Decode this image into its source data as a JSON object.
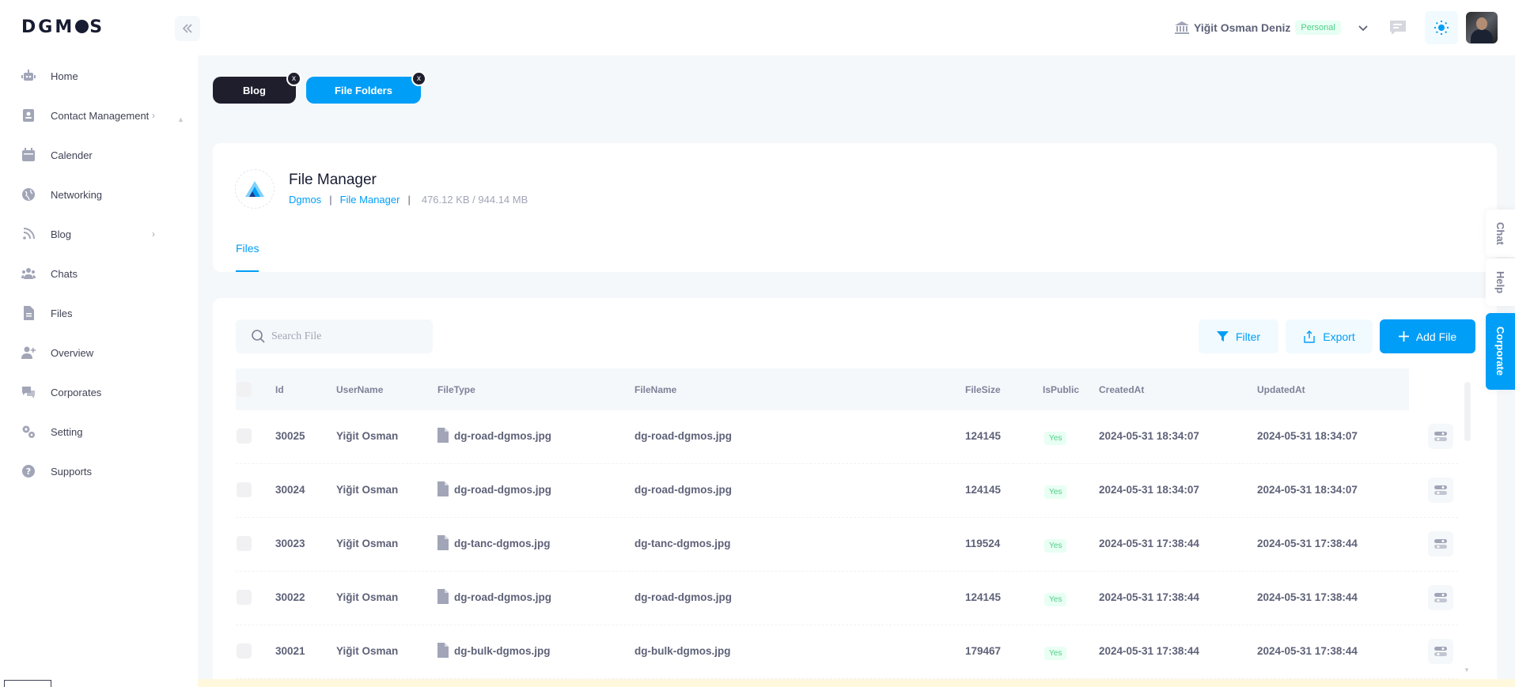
{
  "header": {
    "logo": "DGM",
    "logo_tail": "S",
    "user_name": "Yiğit Osman Deniz",
    "account_type": "Personal"
  },
  "sidebar": {
    "items": [
      {
        "label": "Home",
        "icon": "robot-icon"
      },
      {
        "label": "Contact Management",
        "icon": "contact-book-icon",
        "has_arrow": true
      },
      {
        "label": "Calender",
        "icon": "calendar-icon"
      },
      {
        "label": "Networking",
        "icon": "globe-icon"
      },
      {
        "label": "Blog",
        "icon": "rss-icon",
        "has_arrow": true
      },
      {
        "label": "Chats",
        "icon": "users-icon"
      },
      {
        "label": "Files",
        "icon": "file-icon"
      },
      {
        "label": "Overview",
        "icon": "user-plus-icon"
      },
      {
        "label": "Corporates",
        "icon": "chat-bubbles-icon"
      },
      {
        "label": "Setting",
        "icon": "gears-icon"
      },
      {
        "label": "Supports",
        "icon": "question-icon"
      }
    ]
  },
  "open_tabs": [
    {
      "label": "Blog",
      "close": "x"
    },
    {
      "label": "File Folders",
      "close": "x"
    }
  ],
  "file_manager": {
    "title": "File Manager",
    "crumb_root": "Dgmos",
    "crumb_current": "File Manager",
    "separator": "|",
    "storage": "476.12 KB / 944.14 MB",
    "tab_files": "Files"
  },
  "toolbar": {
    "search_placeholder": "Search File",
    "filter_label": "Filter",
    "export_label": "Export",
    "add_label": "Add File"
  },
  "table": {
    "columns": [
      "Id",
      "UserName",
      "FileType",
      "FileName",
      "FileSize",
      "IsPublic",
      "CreatedAt",
      "UpdatedAt"
    ],
    "rows": [
      {
        "id": "30025",
        "user": "Yiğit Osman",
        "type": "dg-road-dgmos.jpg",
        "name": "dg-road-dgmos.jpg",
        "size": "124145",
        "public": "Yes",
        "created": "2024-05-31 18:34:07",
        "updated": "2024-05-31 18:34:07"
      },
      {
        "id": "30024",
        "user": "Yiğit Osman",
        "type": "dg-road-dgmos.jpg",
        "name": "dg-road-dgmos.jpg",
        "size": "124145",
        "public": "Yes",
        "created": "2024-05-31 18:34:07",
        "updated": "2024-05-31 18:34:07"
      },
      {
        "id": "30023",
        "user": "Yiğit Osman",
        "type": "dg-tanc-dgmos.jpg",
        "name": "dg-tanc-dgmos.jpg",
        "size": "119524",
        "public": "Yes",
        "created": "2024-05-31 17:38:44",
        "updated": "2024-05-31 17:38:44"
      },
      {
        "id": "30022",
        "user": "Yiğit Osman",
        "type": "dg-road-dgmos.jpg",
        "name": "dg-road-dgmos.jpg",
        "size": "124145",
        "public": "Yes",
        "created": "2024-05-31 17:38:44",
        "updated": "2024-05-31 17:38:44"
      },
      {
        "id": "30021",
        "user": "Yiğit Osman",
        "type": "dg-bulk-dgmos.jpg",
        "name": "dg-bulk-dgmos.jpg",
        "size": "179467",
        "public": "Yes",
        "created": "2024-05-31 17:38:44",
        "updated": "2024-05-31 17:38:44"
      }
    ]
  },
  "float_tabs": {
    "chat": "Chat",
    "help": "Help",
    "corporate": "Corporate"
  },
  "colors": {
    "primary": "#009ef7",
    "dark": "#1e1e2d",
    "success": "#50cd89"
  }
}
